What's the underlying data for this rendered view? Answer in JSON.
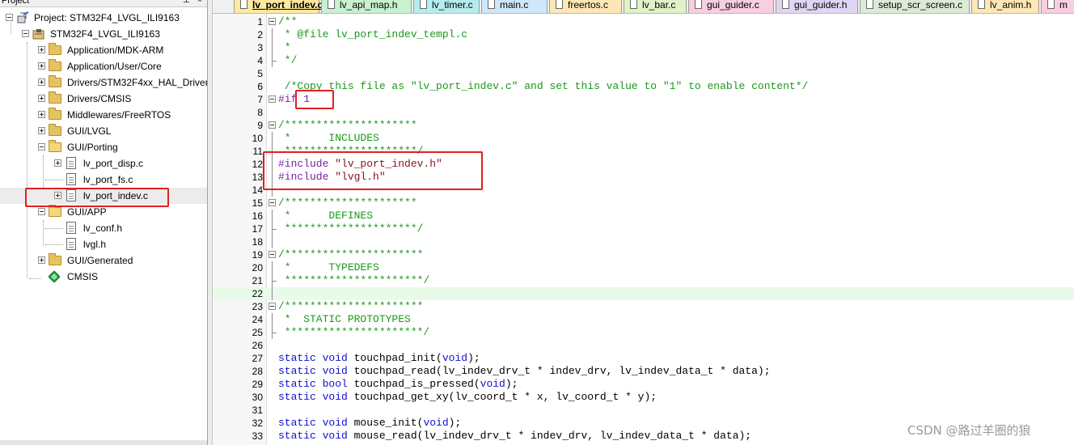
{
  "project_panel": {
    "title": "Project",
    "pin_glyph": "⊥",
    "close_glyph": "×",
    "tree": [
      {
        "label": "Project: STM32F4_LVGL_ILI9163",
        "icon": "project-icon"
      },
      {
        "label": "STM32F4_LVGL_ILI9163",
        "icon": "target-icon"
      },
      {
        "label": "Application/MDK-ARM",
        "icon": "folder-icon"
      },
      {
        "label": "Application/User/Core",
        "icon": "folder-icon"
      },
      {
        "label": "Drivers/STM32F4xx_HAL_Driver",
        "icon": "folder-icon"
      },
      {
        "label": "Drivers/CMSIS",
        "icon": "folder-icon"
      },
      {
        "label": "Middlewares/FreeRTOS",
        "icon": "folder-icon"
      },
      {
        "label": "GUI/LVGL",
        "icon": "folder-icon"
      },
      {
        "label": "GUI/Porting",
        "icon": "folder-open-icon"
      },
      {
        "label": "lv_port_disp.c",
        "icon": "file-icon"
      },
      {
        "label": "lv_port_fs.c",
        "icon": "file-icon"
      },
      {
        "label": "lv_port_indev.c",
        "icon": "file-icon"
      },
      {
        "label": "GUI/APP",
        "icon": "folder-open-icon"
      },
      {
        "label": "lv_conf.h",
        "icon": "file-icon"
      },
      {
        "label": "lvgl.h",
        "icon": "file-icon"
      },
      {
        "label": "GUI/Generated",
        "icon": "folder-icon"
      },
      {
        "label": "CMSIS",
        "icon": "gem-icon"
      }
    ]
  },
  "tabs": [
    {
      "label": "lv_port_indev.c",
      "color": "#ffe8a0",
      "active": true
    },
    {
      "label": "lv_api_map.h",
      "color": "#c9f0cf"
    },
    {
      "label": "lv_timer.c",
      "color": "#b6ecec"
    },
    {
      "label": "main.c",
      "color": "#cfe7fb"
    },
    {
      "label": "freertos.c",
      "color": "#fde7b5"
    },
    {
      "label": "lv_bar.c",
      "color": "#dff2c8"
    },
    {
      "label": "gui_guider.c",
      "color": "#f8cfe0"
    },
    {
      "label": "gui_guider.h",
      "color": "#e0d6f3"
    },
    {
      "label": "setup_scr_screen.c",
      "color": "#dcebd8"
    },
    {
      "label": "lv_anim.h",
      "color": "#fde7b5"
    },
    {
      "label": "m",
      "color": "#f8cfe0"
    }
  ],
  "editor": {
    "lines": [
      {
        "n": "1",
        "tokens": [
          {
            "t": "/**",
            "c": "comment"
          }
        ]
      },
      {
        "n": "2",
        "tokens": [
          {
            "t": " * @file lv_port_indev_templ.c",
            "c": "comment"
          }
        ]
      },
      {
        "n": "3",
        "tokens": [
          {
            "t": " *",
            "c": "comment"
          }
        ]
      },
      {
        "n": "4",
        "tokens": [
          {
            "t": " */",
            "c": "comment"
          }
        ]
      },
      {
        "n": "5",
        "tokens": []
      },
      {
        "n": "6",
        "tokens": [
          {
            "t": " /*Copy this file as \"lv_port_indev.c\" and set this value to \"1\" to enable content*/",
            "c": "comment"
          }
        ]
      },
      {
        "n": "7",
        "tokens": [
          {
            "t": "#if ",
            "c": "pre"
          },
          {
            "t": "1",
            "c": "num"
          }
        ]
      },
      {
        "n": "8",
        "tokens": []
      },
      {
        "n": "9",
        "tokens": [
          {
            "t": "/*********************",
            "c": "comment"
          }
        ]
      },
      {
        "n": "10",
        "tokens": [
          {
            "t": " *      INCLUDES",
            "c": "comment"
          }
        ]
      },
      {
        "n": "11",
        "tokens": [
          {
            "t": " *********************/",
            "c": "comment"
          }
        ]
      },
      {
        "n": "12",
        "tokens": [
          {
            "t": "#include ",
            "c": "pre"
          },
          {
            "t": "\"lv_port_indev.h\"",
            "c": "str"
          }
        ]
      },
      {
        "n": "13",
        "tokens": [
          {
            "t": "#include ",
            "c": "pre"
          },
          {
            "t": "\"lvgl.h\"",
            "c": "str"
          }
        ]
      },
      {
        "n": "14",
        "tokens": []
      },
      {
        "n": "15",
        "tokens": [
          {
            "t": "/*********************",
            "c": "comment"
          }
        ]
      },
      {
        "n": "16",
        "tokens": [
          {
            "t": " *      DEFINES",
            "c": "comment"
          }
        ]
      },
      {
        "n": "17",
        "tokens": [
          {
            "t": " *********************/",
            "c": "comment"
          }
        ]
      },
      {
        "n": "18",
        "tokens": []
      },
      {
        "n": "19",
        "tokens": [
          {
            "t": "/**********************",
            "c": "comment"
          }
        ]
      },
      {
        "n": "20",
        "tokens": [
          {
            "t": " *      TYPEDEFS",
            "c": "comment"
          }
        ]
      },
      {
        "n": "21",
        "tokens": [
          {
            "t": " **********************/",
            "c": "comment"
          }
        ]
      },
      {
        "n": "22",
        "tokens": []
      },
      {
        "n": "23",
        "tokens": [
          {
            "t": "/**********************",
            "c": "comment"
          }
        ]
      },
      {
        "n": "24",
        "tokens": [
          {
            "t": " *  STATIC PROTOTYPES",
            "c": "comment"
          }
        ]
      },
      {
        "n": "25",
        "tokens": [
          {
            "t": " **********************/",
            "c": "comment"
          }
        ]
      },
      {
        "n": "26",
        "tokens": []
      },
      {
        "n": "27",
        "tokens": [
          {
            "t": "static void ",
            "c": "kw"
          },
          {
            "t": "touchpad_init(",
            "c": "plain"
          },
          {
            "t": "void",
            "c": "kw"
          },
          {
            "t": ");",
            "c": "plain"
          }
        ]
      },
      {
        "n": "28",
        "tokens": [
          {
            "t": "static void ",
            "c": "kw"
          },
          {
            "t": "touchpad_read(lv_indev_drv_t * indev_drv, lv_indev_data_t * data);",
            "c": "plain"
          }
        ]
      },
      {
        "n": "29",
        "tokens": [
          {
            "t": "static bool ",
            "c": "kw"
          },
          {
            "t": "touchpad_is_pressed(",
            "c": "plain"
          },
          {
            "t": "void",
            "c": "kw"
          },
          {
            "t": ");",
            "c": "plain"
          }
        ]
      },
      {
        "n": "30",
        "tokens": [
          {
            "t": "static void ",
            "c": "kw"
          },
          {
            "t": "touchpad_get_xy(lv_coord_t * x, lv_coord_t * y);",
            "c": "plain"
          }
        ]
      },
      {
        "n": "31",
        "tokens": []
      },
      {
        "n": "32",
        "tokens": [
          {
            "t": "static void ",
            "c": "kw"
          },
          {
            "t": "mouse_init(",
            "c": "plain"
          },
          {
            "t": "void",
            "c": "kw"
          },
          {
            "t": ");",
            "c": "plain"
          }
        ]
      },
      {
        "n": "33",
        "tokens": [
          {
            "t": "static void ",
            "c": "kw"
          },
          {
            "t": "mouse_read(lv_indev_drv_t * indev_drv, lv_indev_data_t * data);",
            "c": "plain"
          }
        ]
      }
    ]
  },
  "watermark": "CSDN @路过羊圈的狼"
}
